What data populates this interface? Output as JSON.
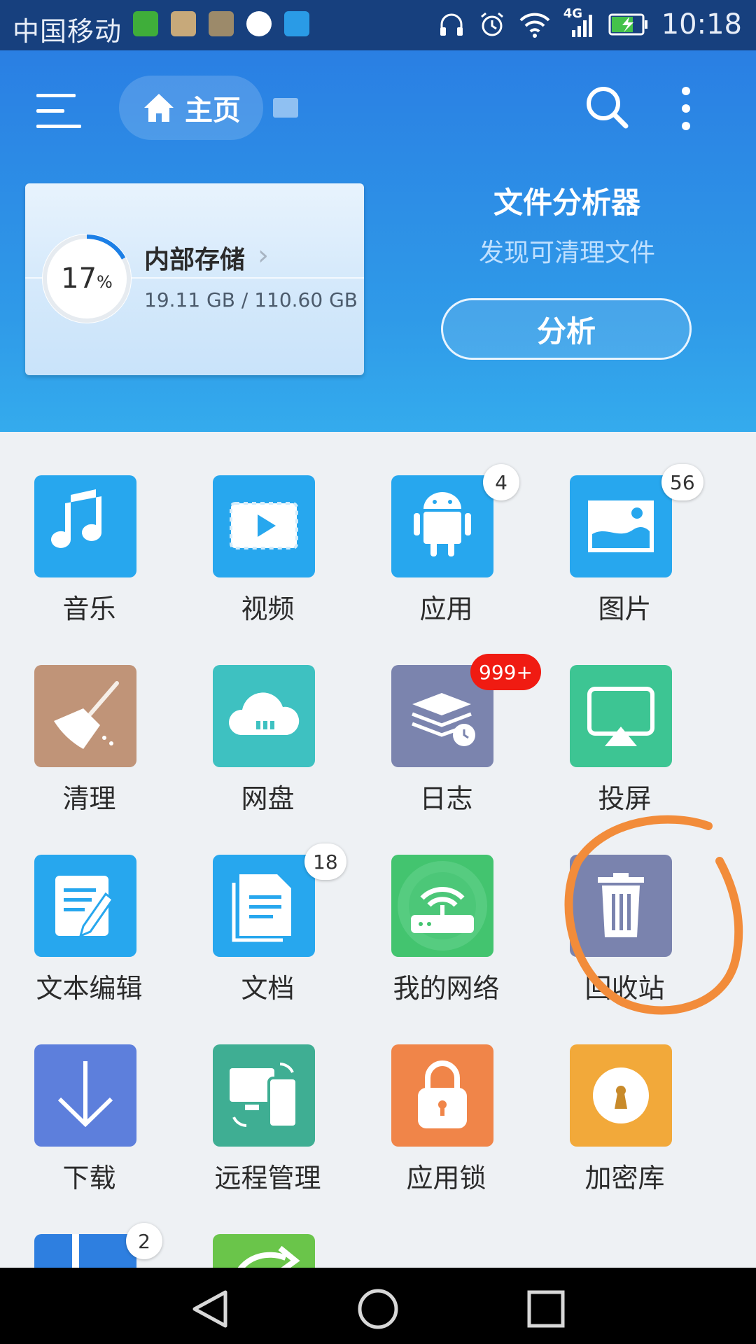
{
  "status_bar": {
    "carrier": "中国移动",
    "network": "4G",
    "time": "10:18"
  },
  "toolbar": {
    "home_label": "主页"
  },
  "storage": {
    "percent": "17",
    "percent_sign": "%",
    "percent_value": 17,
    "title": "内部存储",
    "size": "19.11 GB / 110.60 GB"
  },
  "analyzer": {
    "title": "文件分析器",
    "subtitle": "发现可清理文件",
    "button_label": "分析"
  },
  "grid": {
    "items": [
      {
        "label": "音乐",
        "icon": "music-icon",
        "color": "#27a7ee"
      },
      {
        "label": "视频",
        "icon": "video-icon",
        "color": "#27a7ee"
      },
      {
        "label": "应用",
        "icon": "android-icon",
        "color": "#27a7ee",
        "badge": "4"
      },
      {
        "label": "图片",
        "icon": "image-icon",
        "color": "#27a7ee",
        "badge": "56"
      },
      {
        "label": "清理",
        "icon": "broom-icon",
        "color": "#c09478"
      },
      {
        "label": "网盘",
        "icon": "cloud-icon",
        "color": "#3ec1c1"
      },
      {
        "label": "日志",
        "icon": "log-icon",
        "color": "#7b84ae",
        "badge": "999+"
      },
      {
        "label": "投屏",
        "icon": "cast-icon",
        "color": "#3dc593"
      },
      {
        "label": "文本编辑",
        "icon": "edit-icon",
        "color": "#27a7ee"
      },
      {
        "label": "文档",
        "icon": "document-icon",
        "color": "#27a7ee",
        "badge": "18"
      },
      {
        "label": "我的网络",
        "icon": "router-icon",
        "color": "#43c46f"
      },
      {
        "label": "回收站",
        "icon": "trash-icon",
        "color": "#7a83ae"
      },
      {
        "label": "下载",
        "icon": "download-icon",
        "color": "#5d7fdc"
      },
      {
        "label": "远程管理",
        "icon": "remote-icon",
        "color": "#3fae93"
      },
      {
        "label": "应用锁",
        "icon": "lock-icon",
        "color": "#f08549"
      },
      {
        "label": "加密库",
        "icon": "vault-icon",
        "color": "#f2a93a"
      },
      {
        "label": "",
        "icon": "archive-icon",
        "color": "#2e7fe0",
        "badge": "2"
      },
      {
        "label": "",
        "icon": "share-icon",
        "color": "#6ac54a"
      }
    ]
  },
  "annotation_color": "#f28c3a"
}
